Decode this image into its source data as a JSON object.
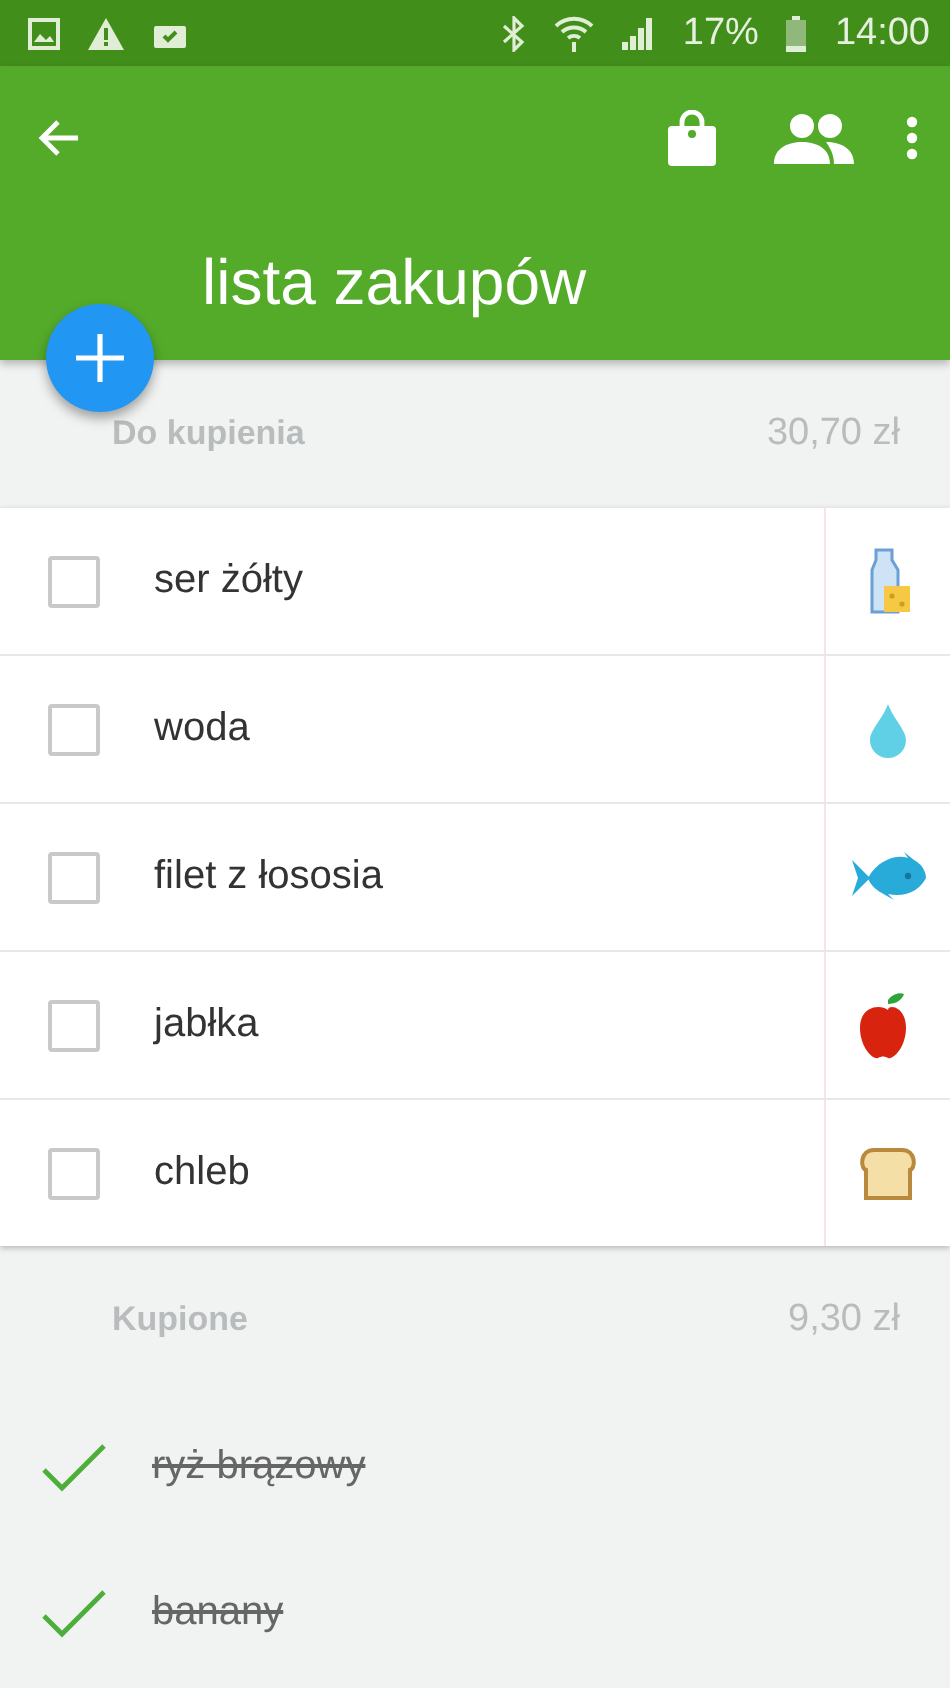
{
  "status_bar": {
    "battery": "17%",
    "time": "14:00"
  },
  "app_bar": {
    "title": "lista zakupów"
  },
  "sections": [
    {
      "kind": "card",
      "title": "Do kupienia",
      "total": "30,70 zł",
      "items": [
        {
          "name": "ser żółty",
          "checked": false,
          "kind": "dairy"
        },
        {
          "name": "woda",
          "checked": false,
          "kind": "water"
        },
        {
          "name": "filet z łososia",
          "checked": false,
          "kind": "fish"
        },
        {
          "name": "jabłka",
          "checked": false,
          "kind": "apple"
        },
        {
          "name": "chleb",
          "checked": false,
          "kind": "bread"
        }
      ]
    },
    {
      "kind": "plain",
      "title": "Kupione",
      "total": "9,30 zł",
      "items": [
        {
          "name": "ryż brązowy",
          "checked": true
        },
        {
          "name": "banany",
          "checked": true
        }
      ]
    }
  ]
}
